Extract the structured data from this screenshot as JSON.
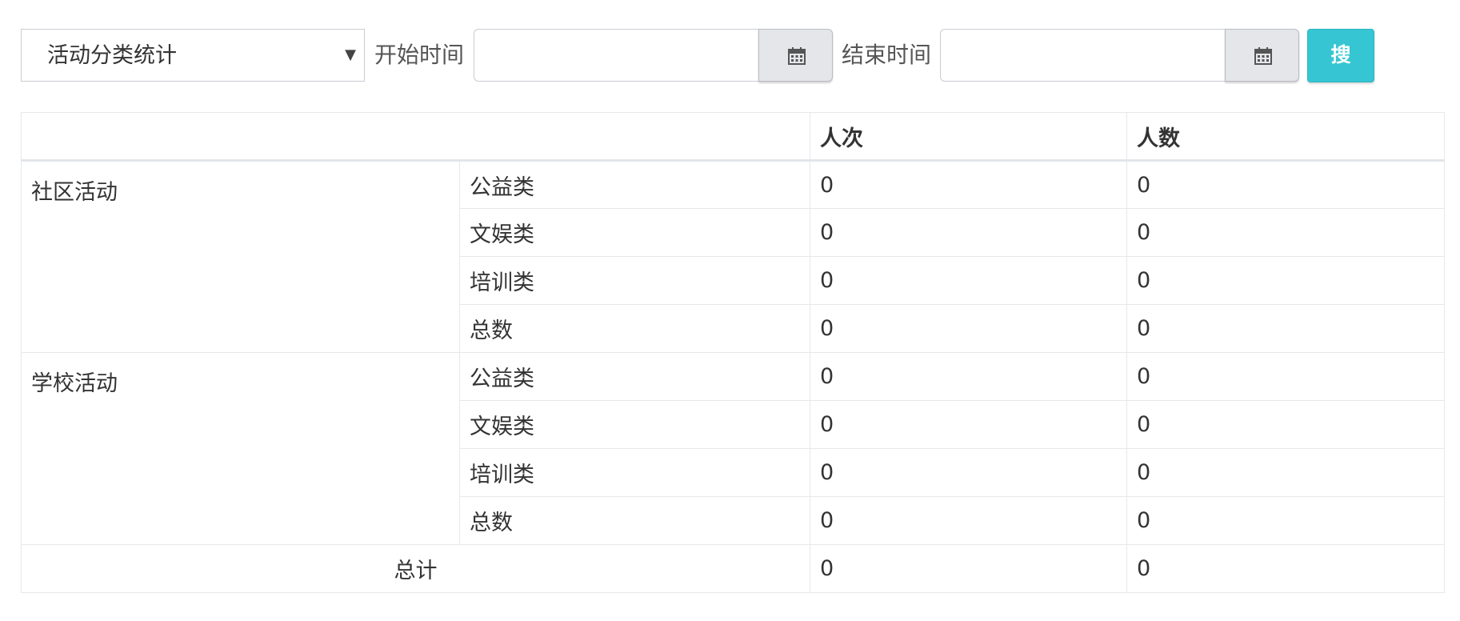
{
  "filter": {
    "category_select": "活动分类统计",
    "start_label": "开始时间",
    "start_value": "",
    "end_label": "结束时间",
    "end_value": "",
    "calendar_icon": "calendar-icon",
    "search_label": "搜"
  },
  "table": {
    "headers": [
      "",
      "人次",
      "人数"
    ],
    "groups": [
      {
        "name": "社区活动",
        "rows": [
          {
            "label": "公益类",
            "visits": "0",
            "people": "0"
          },
          {
            "label": "文娱类",
            "visits": "0",
            "people": "0"
          },
          {
            "label": "培训类",
            "visits": "0",
            "people": "0"
          },
          {
            "label": "总数",
            "visits": "0",
            "people": "0"
          }
        ]
      },
      {
        "name": "学校活动",
        "rows": [
          {
            "label": "公益类",
            "visits": "0",
            "people": "0"
          },
          {
            "label": "文娱类",
            "visits": "0",
            "people": "0"
          },
          {
            "label": "培训类",
            "visits": "0",
            "people": "0"
          },
          {
            "label": "总数",
            "visits": "0",
            "people": "0"
          }
        ]
      }
    ],
    "total": {
      "label": "总计",
      "visits": "0",
      "people": "0"
    }
  },
  "colors": {
    "accent": "#36c6d3",
    "border": "#e6e8ea",
    "addon_bg": "#e4e6ea"
  }
}
